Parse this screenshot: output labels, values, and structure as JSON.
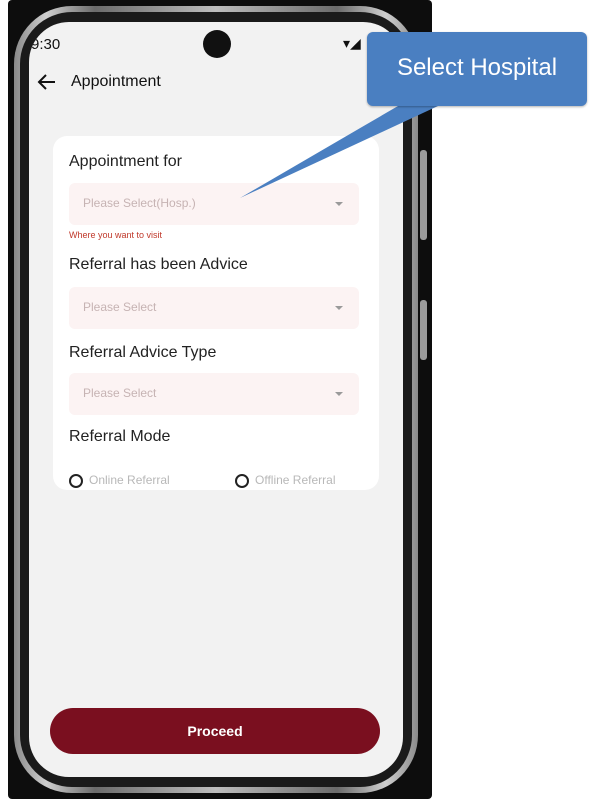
{
  "status_bar": {
    "time": "9:30"
  },
  "app_bar": {
    "title": "Appointment"
  },
  "form": {
    "appointment_for": {
      "label": "Appointment for",
      "placeholder": "Please Select(Hosp.)",
      "helper": "Where you want to visit"
    },
    "referral_advice": {
      "label": "Referral has been Advice",
      "placeholder": "Please Select"
    },
    "referral_advice_type": {
      "label": "Referral  Advice Type",
      "placeholder": "Please Select"
    },
    "referral_mode": {
      "label": "Referral  Mode",
      "options": [
        "Online Referral",
        "Offline Referral"
      ]
    }
  },
  "proceed_label": "Proceed",
  "callout": {
    "text": "Select Hospital",
    "color": "#4a7fc1"
  },
  "colors": {
    "primary": "#7a0f1f",
    "error": "#c0392b",
    "screen_bg": "#f2f2f2"
  }
}
